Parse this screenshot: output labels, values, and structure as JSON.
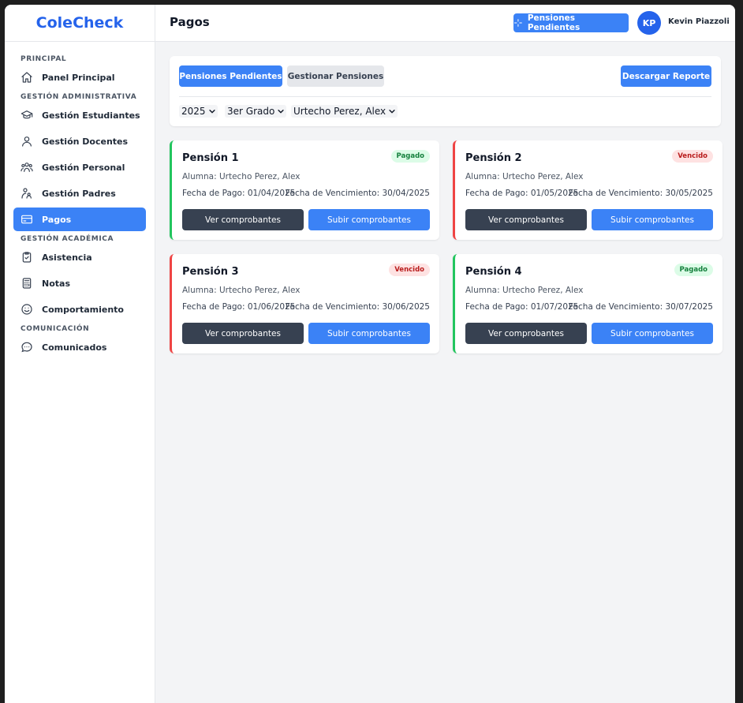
{
  "app": {
    "brand": "ColeCheck"
  },
  "colors": {
    "accent": "#3b82f6",
    "brand": "#2563eb",
    "paid": "#22c55e",
    "overdue": "#ef4444"
  },
  "sidebar": {
    "sections": [
      {
        "label": "PRINCIPAL",
        "items": [
          {
            "label": "Panel Principal",
            "icon": "home-icon"
          }
        ]
      },
      {
        "label": "GESTIÓN ADMINISTRATIVA",
        "items": [
          {
            "label": "Gestión Estudiantes",
            "icon": "school-icon"
          },
          {
            "label": "Gestión Docentes",
            "icon": "user-icon"
          },
          {
            "label": "Gestión Personal",
            "icon": "users-icon"
          },
          {
            "label": "Gestión Padres",
            "icon": "parent-icon"
          },
          {
            "label": "Pagos",
            "icon": "credit-card-icon",
            "active": true
          }
        ]
      },
      {
        "label": "GESTIÓN ACADÉMICA",
        "items": [
          {
            "label": "Asistencia",
            "icon": "clipboard-check-icon"
          },
          {
            "label": "Notas",
            "icon": "calculator-icon"
          },
          {
            "label": "Comportamiento",
            "icon": "smile-icon"
          }
        ]
      },
      {
        "label": "COMUNICACIÓN",
        "items": [
          {
            "label": "Comunicados",
            "icon": "chat-icon"
          }
        ]
      }
    ]
  },
  "header": {
    "title": "Pagos",
    "pending_button": "Pensiones Pendientes",
    "avatar_initials": "KP",
    "user_name": "Kevin Piazzoli"
  },
  "toolbar": {
    "tab_pending": "Pensiones Pendientes",
    "tab_manage": "Gestionar Pensiones",
    "download": "Descargar Reporte",
    "filters": {
      "year": "2025",
      "grade": "3er Grado",
      "student": "Urtecho Perez, Alex"
    }
  },
  "pensions": [
    {
      "title": "Pensión 1",
      "status": "Pagado",
      "status_type": "paid",
      "student": "Alumna: Urtecho Perez, Alex",
      "pay_date": "Fecha de Pago: 01/04/2025",
      "due_date": "Fecha de Vencimiento: 30/04/2025",
      "view_label": "Ver comprobantes",
      "upload_label": "Subir comprobantes"
    },
    {
      "title": "Pensión 2",
      "status": "Vencido",
      "status_type": "late",
      "student": "Alumna: Urtecho Perez, Alex",
      "pay_date": "Fecha de Pago: 01/05/2025",
      "due_date": "Fecha de Vencimiento: 30/05/2025",
      "view_label": "Ver comprobantes",
      "upload_label": "Subir comprobantes"
    },
    {
      "title": "Pensión 3",
      "status": "Vencido",
      "status_type": "late",
      "student": "Alumna: Urtecho Perez, Alex",
      "pay_date": "Fecha de Pago: 01/06/2025",
      "due_date": "Fecha de Vencimiento: 30/06/2025",
      "view_label": "Ver comprobantes",
      "upload_label": "Subir comprobantes"
    },
    {
      "title": "Pensión 4",
      "status": "Pagado",
      "status_type": "paid",
      "student": "Alumna: Urtecho Perez, Alex",
      "pay_date": "Fecha de Pago: 01/07/2025",
      "due_date": "Fecha de Vencimiento: 30/07/2025",
      "view_label": "Ver comprobantes",
      "upload_label": "Subir comprobantes"
    }
  ]
}
